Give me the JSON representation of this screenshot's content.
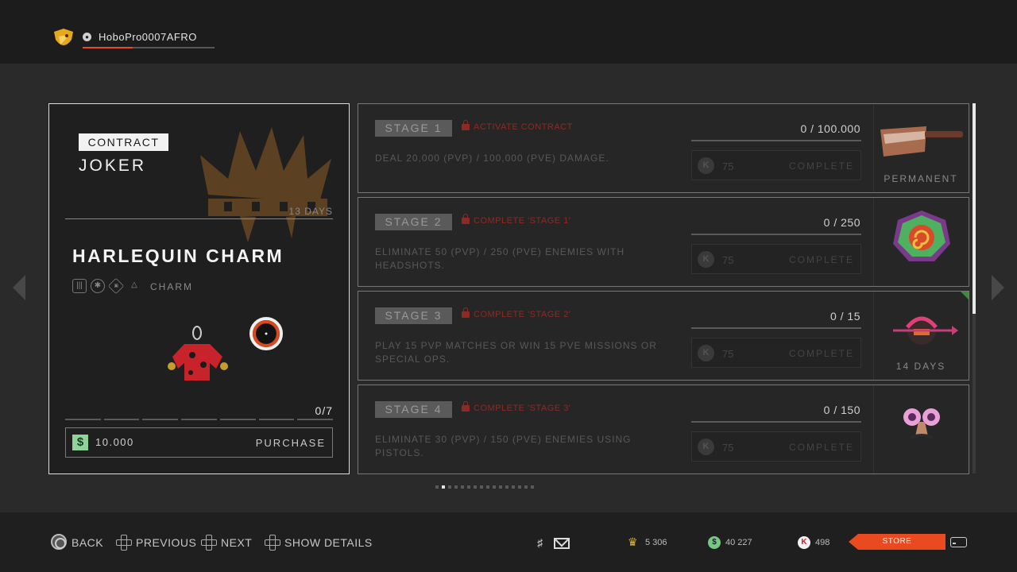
{
  "user": {
    "gamertag": "HoboPro0007AFRO",
    "xp_progress": 0.38
  },
  "contract": {
    "tag": "CONTRACT",
    "name": "JOKER",
    "days_left": "13 DAYS",
    "item_name": "HARLEQUIN CHARM",
    "item_type": "CHARM",
    "progress": "0/7",
    "segments": 7,
    "price": "10.000",
    "purchase_label": "PURCHASE"
  },
  "stages": [
    {
      "badge": "STAGE 1",
      "status": "ACTIVATE CONTRACT",
      "description": "DEAL 20,000 (PVP) / 100,000 (PVE) DAMAGE.",
      "goal": "0 / 100.000",
      "reward_value": "75",
      "complete_label": "COMPLETE",
      "reward_caption": "PERMANENT",
      "reward_icon": "cleaver-icon",
      "flag": false
    },
    {
      "badge": "STAGE 2",
      "status": "COMPLETE 'STAGE 1'",
      "description": "ELIMINATE 50 (PVP) / 250 (PVE) ENEMIES WITH HEADSHOTS.",
      "goal": "0 / 250",
      "reward_value": "75",
      "complete_label": "COMPLETE",
      "reward_caption": "",
      "reward_icon": "spiral-emblem-icon",
      "flag": false
    },
    {
      "badge": "STAGE 3",
      "status": "COMPLETE 'STAGE 2'",
      "description": "PLAY 15 PVP MATCHES OR WIN 15 PVE MISSIONS OR SPECIAL OPS.",
      "goal": "0 / 15",
      "reward_value": "75",
      "complete_label": "COMPLETE",
      "reward_caption": "14 DAYS",
      "reward_icon": "arrow-helmet-icon",
      "flag": true
    },
    {
      "badge": "STAGE 4",
      "status": "COMPLETE 'STAGE 3'",
      "description": "ELIMINATE 30 (PVP) / 150 (PVE) ENEMIES USING PISTOLS.",
      "goal": "0 / 150",
      "reward_value": "75",
      "complete_label": "COMPLETE",
      "reward_caption": "",
      "reward_icon": "novelty-glasses-icon",
      "flag": false
    }
  ],
  "pager": {
    "count": 16,
    "active": 1
  },
  "bottom": {
    "back": "BACK",
    "previous": "PREVIOUS",
    "next": "NEXT",
    "show_details": "SHOW DETAILS",
    "crowns": "5 306",
    "cash": "40 227",
    "k_credits": "498",
    "store": "STORE"
  },
  "colors": {
    "accent": "#e94a1f",
    "locked": "#8e2a24",
    "cash": "#8ed49a"
  }
}
